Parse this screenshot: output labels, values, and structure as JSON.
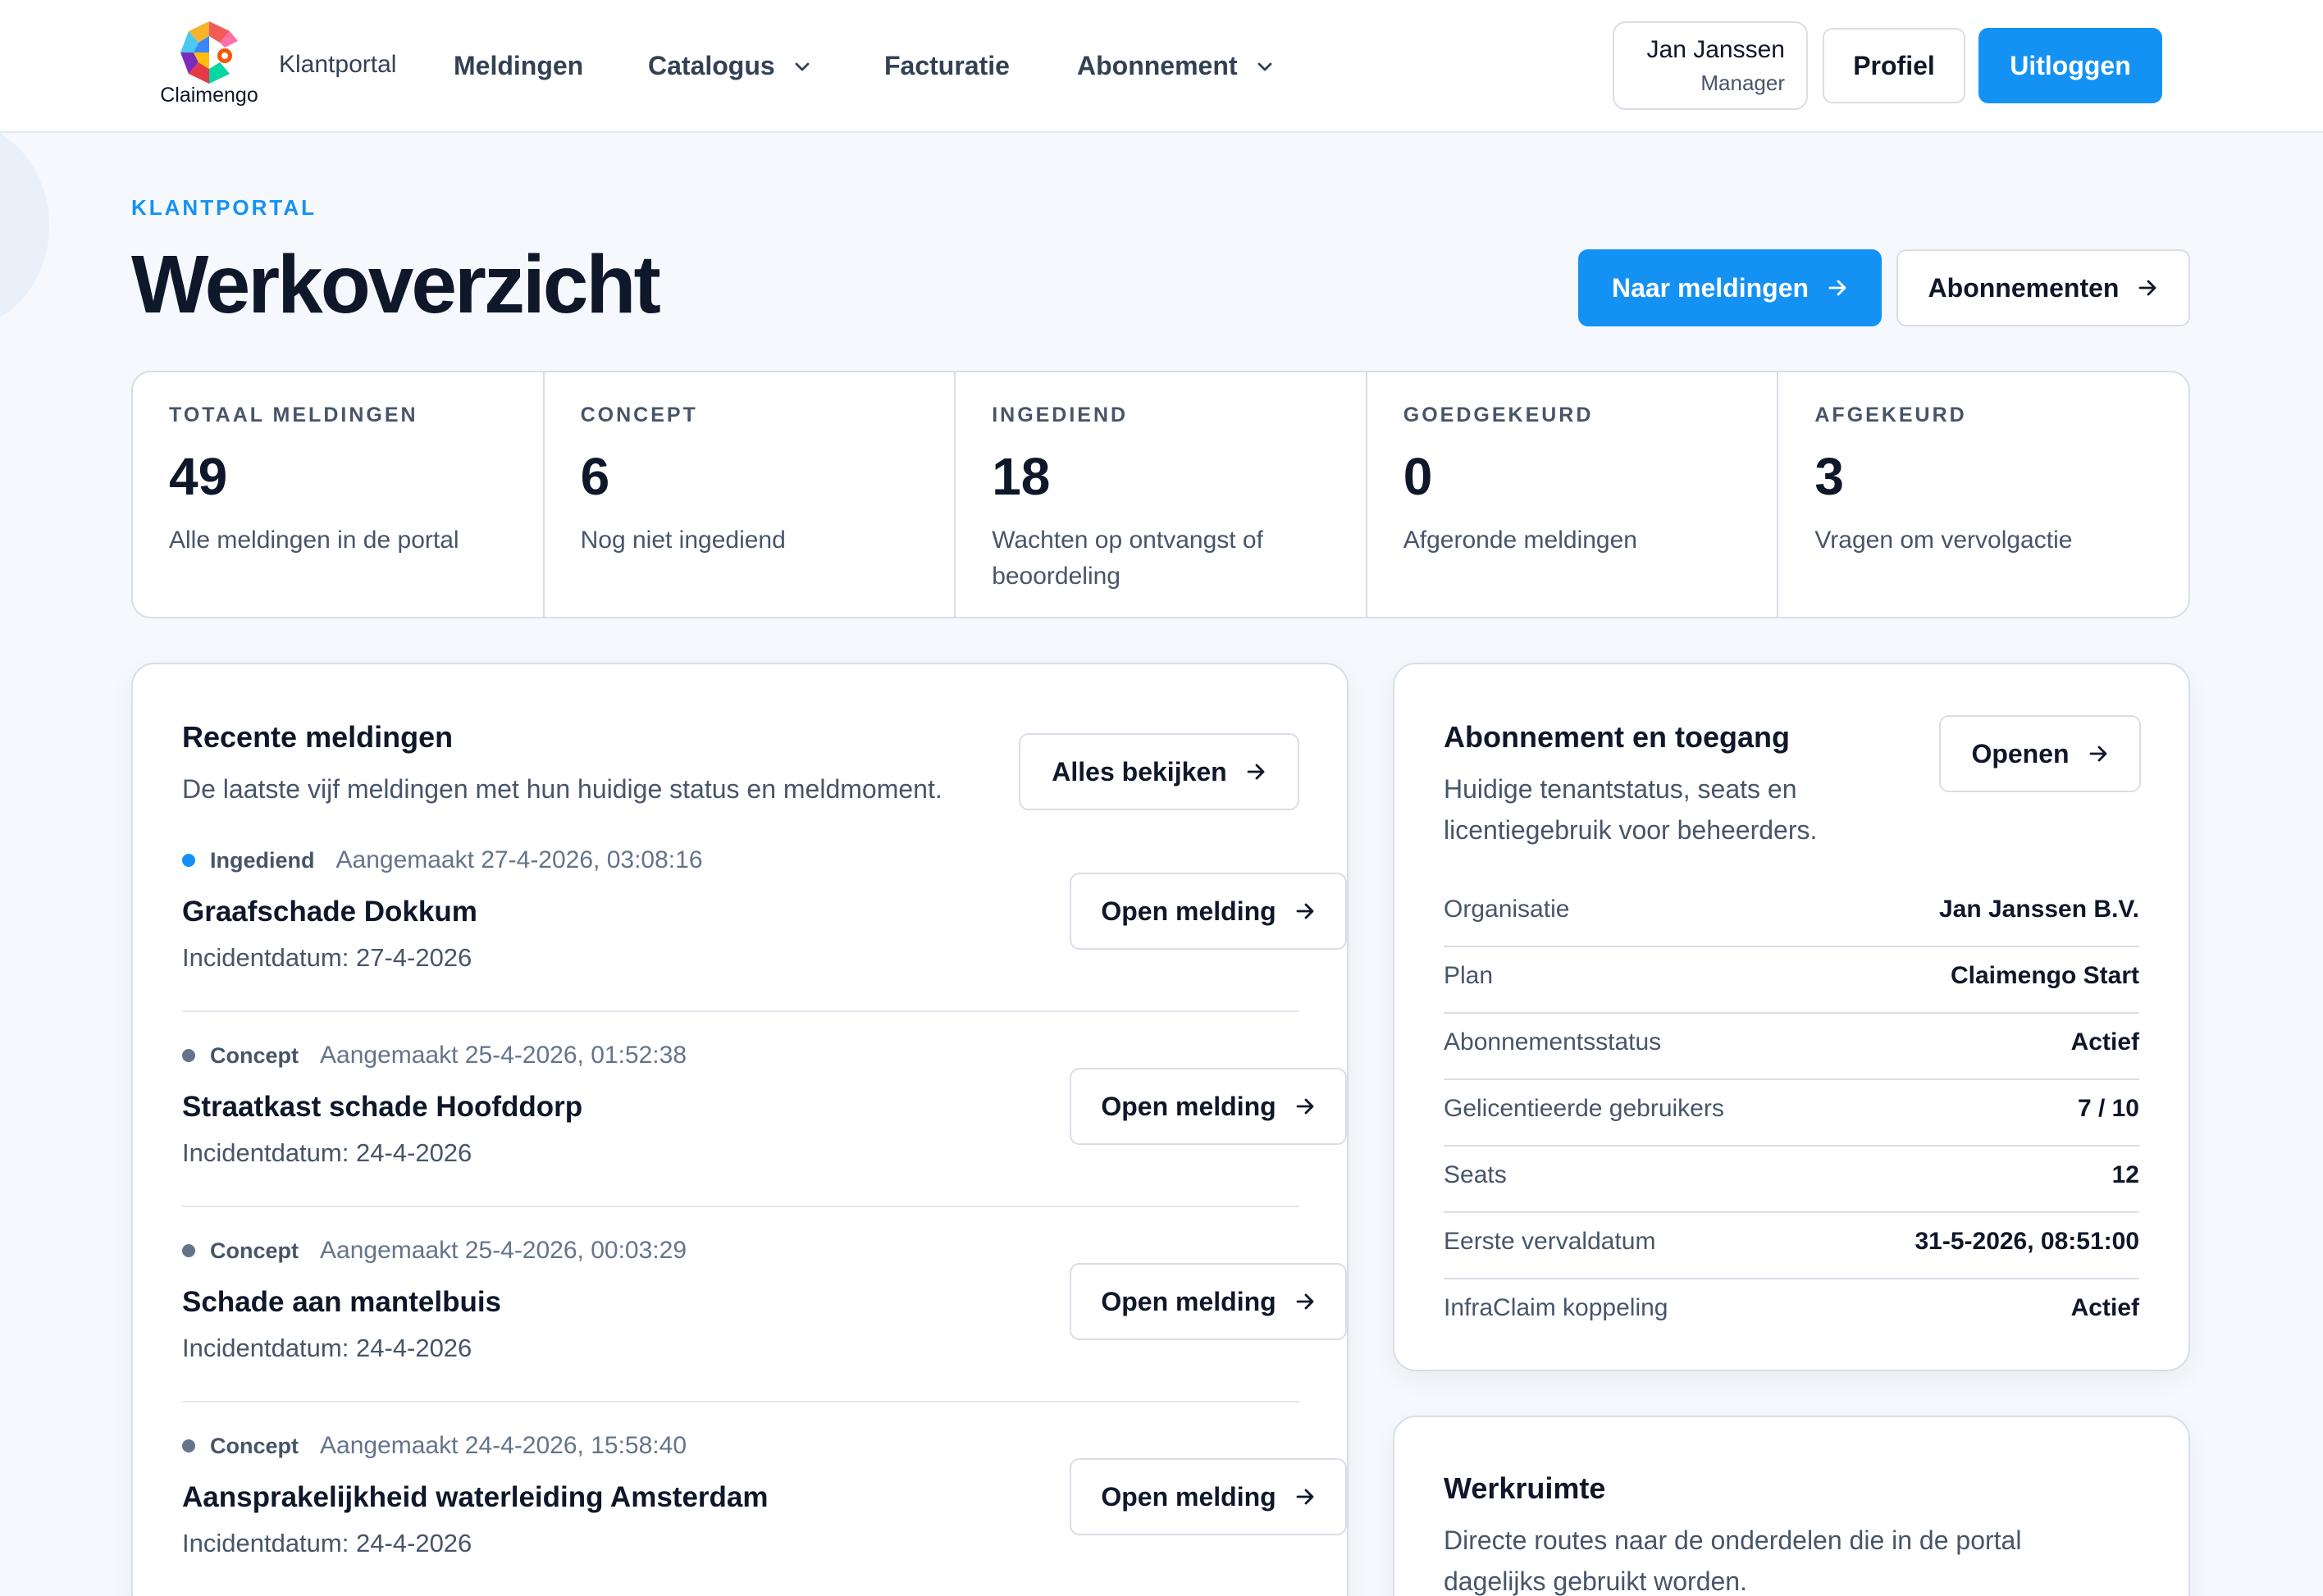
{
  "header": {
    "logo_text": "Claimengo",
    "brand_sub": "Klantportal",
    "nav": [
      {
        "label": "Meldingen"
      },
      {
        "label": "Catalogus"
      },
      {
        "label": "Facturatie"
      },
      {
        "label": "Abonnement"
      }
    ],
    "user": {
      "name": "Jan Janssen",
      "role": "Manager"
    },
    "profile_label": "Profiel",
    "logout_label": "Uitloggen"
  },
  "page": {
    "eyebrow": "KLANTPORTAL",
    "title": "Werkoverzicht",
    "primary_action": "Naar meldingen",
    "secondary_action": "Abonnementen"
  },
  "stats": [
    {
      "label": "TOTAAL MELDINGEN",
      "value": "49",
      "desc": "Alle meldingen in de portal"
    },
    {
      "label": "CONCEPT",
      "value": "6",
      "desc": "Nog niet ingediend"
    },
    {
      "label": "INGEDIEND",
      "value": "18",
      "desc": "Wachten op ontvangst of beoordeling"
    },
    {
      "label": "GOEDGEKEURD",
      "value": "0",
      "desc": "Afgeronde meldingen"
    },
    {
      "label": "AFGEKEURD",
      "value": "3",
      "desc": "Vragen om vervolgactie"
    }
  ],
  "recent": {
    "title": "Recente meldingen",
    "subtitle": "De laatste vijf meldingen met hun huidige status en meldmoment.",
    "view_all": "Alles bekijken",
    "open_label": "Open melding",
    "items": [
      {
        "status": "Ingediend",
        "status_color": "#1492f4",
        "created": "Aangemaakt 27-4-2026, 03:08:16",
        "title": "Graafschade Dokkum",
        "incident": "Incidentdatum: 27-4-2026"
      },
      {
        "status": "Concept",
        "status_color": "#64748b",
        "created": "Aangemaakt 25-4-2026, 01:52:38",
        "title": "Straatkast schade Hoofddorp",
        "incident": "Incidentdatum: 24-4-2026"
      },
      {
        "status": "Concept",
        "status_color": "#64748b",
        "created": "Aangemaakt 25-4-2026, 00:03:29",
        "title": "Schade aan mantelbuis",
        "incident": "Incidentdatum: 24-4-2026"
      },
      {
        "status": "Concept",
        "status_color": "#64748b",
        "created": "Aangemaakt 24-4-2026, 15:58:40",
        "title": "Aansprakelijkheid waterleiding Amsterdam",
        "incident": "Incidentdatum: 24-4-2026"
      }
    ]
  },
  "subscription": {
    "title": "Abonnement en toegang",
    "subtitle_line1": "Huidige tenantstatus, seats en",
    "subtitle_line2": "licentiegebruik voor beheerders.",
    "open_label": "Openen",
    "rows": [
      {
        "key": "Organisatie",
        "value": "Jan Janssen B.V."
      },
      {
        "key": "Plan",
        "value": "Claimengo Start"
      },
      {
        "key": "Abonnementsstatus",
        "value": "Actief"
      },
      {
        "key": "Gelicentieerde gebruikers",
        "value": "7 / 10"
      },
      {
        "key": "Seats",
        "value": "12"
      },
      {
        "key": "Eerste vervaldatum",
        "value": "31-5-2026, 08:51:00"
      },
      {
        "key": "InfraClaim koppeling",
        "value": "Actief"
      }
    ]
  },
  "workspace": {
    "title": "Werkruimte",
    "subtitle_line1": "Directe routes naar de onderdelen die in de portal",
    "subtitle_line2": "dagelijks gebruikt worden."
  },
  "colors": {
    "accent": "#1492f4",
    "text": "#0f172a",
    "muted": "#475569",
    "border": "#d9dee6"
  }
}
